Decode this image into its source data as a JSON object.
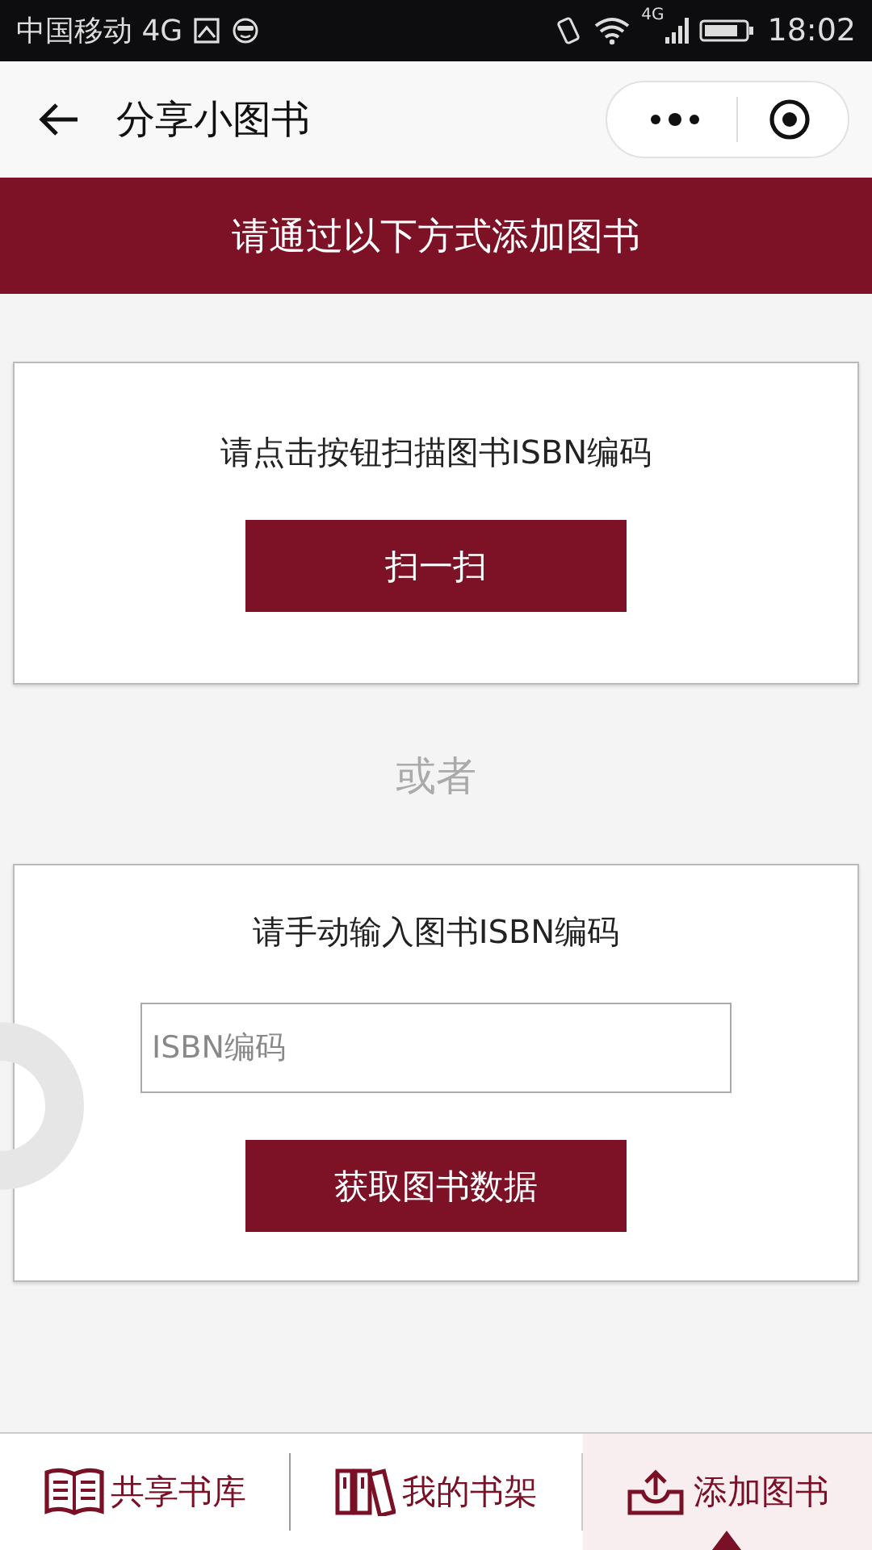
{
  "status_bar": {
    "carrier": "中国移动 4G",
    "network": "4G",
    "time": "18:02"
  },
  "nav": {
    "title": "分享小图书"
  },
  "banner": "请通过以下方式添加图书",
  "scan_card": {
    "prompt": "请点击按钮扫描图书ISBN编码",
    "button": "扫一扫"
  },
  "divider_text": "或者",
  "manual_card": {
    "prompt": "请手动输入图书ISBN编码",
    "placeholder": "ISBN编码",
    "button": "获取图书数据"
  },
  "tab_bar": [
    {
      "label": "共享书库",
      "kind": "library",
      "selected": false
    },
    {
      "label": "我的书架",
      "kind": "shelf",
      "selected": false
    },
    {
      "label": "添加图书",
      "kind": "add",
      "selected": true
    }
  ]
}
